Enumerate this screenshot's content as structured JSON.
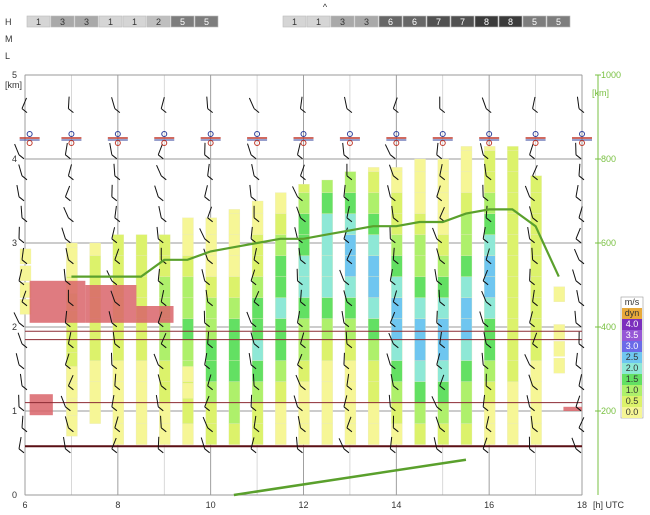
{
  "ui": {
    "collapse_glyph": "^",
    "hml_labels": [
      "H",
      "M",
      "L"
    ],
    "utc_label": "[h] UTC"
  },
  "cloud_row": {
    "group1": [
      "1",
      "3",
      "3",
      "1",
      "1",
      "2",
      "5",
      "5"
    ],
    "group2": [
      "1",
      "1",
      "3",
      "3",
      "6",
      "6",
      "7",
      "7",
      "8",
      "8",
      "5",
      "5"
    ]
  },
  "chart_data": {
    "type": "heatmap",
    "x_unit": "h UTC",
    "x_ticks": [
      6,
      8,
      10,
      12,
      14,
      16,
      18
    ],
    "xlim": [
      6,
      18
    ],
    "y_left_unit": "[km]",
    "y_left_ticks": [
      0,
      1,
      2,
      3,
      4,
      5
    ],
    "ylim_left": [
      0,
      5
    ],
    "y_right_unit": "[km]",
    "y_right_ticks": [
      200,
      400,
      600,
      800,
      1000
    ],
    "ylim_right": [
      0,
      1000
    ],
    "grid": true,
    "legend_position": "right",
    "legend": {
      "title": "m/s",
      "entries": [
        {
          "label": "dyn",
          "color": "#e8a93a"
        },
        {
          "label": "4.0",
          "color": "#7b2fbd"
        },
        {
          "label": "3.5",
          "color": "#9657d6"
        },
        {
          "label": "3.0",
          "color": "#6b6be8"
        },
        {
          "label": "2.5",
          "color": "#6fc6f0"
        },
        {
          "label": "2.0",
          "color": "#8ee8d6"
        },
        {
          "label": "1.5",
          "color": "#63e063"
        },
        {
          "label": "1.0",
          "color": "#aef06b"
        },
        {
          "label": "0.5",
          "color": "#dcf26b"
        },
        {
          "label": "0.0",
          "color": "#f6f696"
        }
      ]
    },
    "column_times": [
      7,
      7.5,
      8,
      8.5,
      9,
      9.5,
      10,
      10.5,
      11,
      11.5,
      12,
      12.5,
      13,
      13.5,
      14,
      14.5,
      15,
      15.5,
      16,
      16.5,
      17
    ],
    "column_tops_km": [
      3.0,
      3.0,
      3.1,
      3.1,
      3.1,
      3.3,
      3.3,
      3.4,
      3.5,
      3.6,
      3.7,
      3.75,
      3.85,
      3.9,
      3.9,
      4.0,
      4.0,
      4.15,
      4.15,
      4.15,
      3.8
    ],
    "column_bottoms_km": [
      0.7,
      0.85,
      0.6,
      0.6,
      0.6,
      0.6,
      0.6,
      0.6,
      0.6,
      0.6,
      0.6,
      0.6,
      0.6,
      0.6,
      0.6,
      0.6,
      0.6,
      0.6,
      0.6,
      0.6,
      0.6
    ],
    "boundary_layer_km": [
      [
        7,
        2.6
      ],
      [
        7.5,
        2.6
      ],
      [
        8,
        2.6
      ],
      [
        8.5,
        2.6
      ],
      [
        9,
        2.8
      ],
      [
        9.5,
        2.8
      ],
      [
        10,
        2.9
      ],
      [
        10.5,
        2.95
      ],
      [
        11,
        3.0
      ],
      [
        11.5,
        3.05
      ],
      [
        12,
        3.05
      ],
      [
        12.5,
        3.1
      ],
      [
        13,
        3.15
      ],
      [
        13.5,
        3.2
      ],
      [
        14,
        3.2
      ],
      [
        14.5,
        3.25
      ],
      [
        15,
        3.25
      ],
      [
        15.5,
        3.35
      ],
      [
        16,
        3.4
      ],
      [
        16.5,
        3.4
      ],
      [
        17,
        3.2
      ],
      [
        17.5,
        2.6
      ]
    ],
    "surface_trend_km": [
      [
        10.5,
        0.0
      ],
      [
        15.5,
        0.42
      ]
    ],
    "cloud_patches_km": [
      {
        "t0": 6.1,
        "t1": 7.3,
        "h0": 2.05,
        "h1": 2.55
      },
      {
        "t0": 7.3,
        "t1": 8.4,
        "h0": 2.05,
        "h1": 2.5
      },
      {
        "t0": 8.4,
        "t1": 9.2,
        "h0": 2.05,
        "h1": 2.25
      },
      {
        "t0": 6.1,
        "t1": 6.6,
        "h0": 0.95,
        "h1": 1.2
      },
      {
        "t0": 17.6,
        "t1": 18.0,
        "h0": 1.0,
        "h1": 1.05
      }
    ],
    "inversion_lines_km": [
      0.58,
      1.1,
      1.85,
      1.95
    ],
    "station_marker_km": 4.25,
    "station_times": [
      6.1,
      7,
      8,
      9,
      10,
      11,
      12,
      13,
      14,
      15,
      16,
      17,
      18
    ]
  }
}
